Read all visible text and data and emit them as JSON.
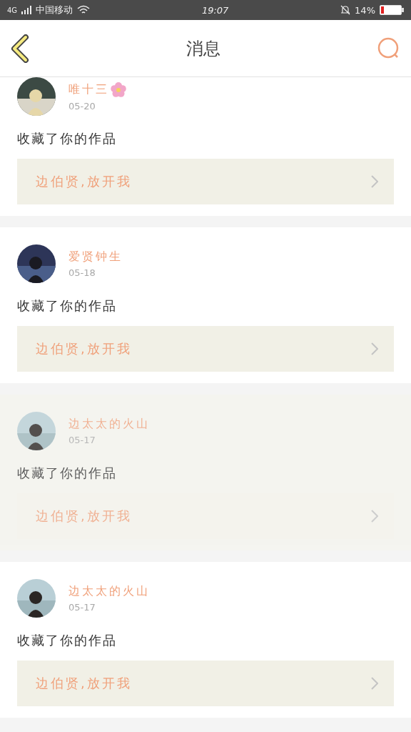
{
  "status_bar": {
    "network": "4G",
    "carrier": "中国移动",
    "time": "19:07",
    "battery": "14%"
  },
  "header": {
    "title": "消息"
  },
  "messages": [
    {
      "user": "唯十三",
      "flower": true,
      "date": "05-20",
      "action": "收藏了你的作品",
      "work": "边伯贤,放开我",
      "pressed": false
    },
    {
      "user": "爱贤钟生",
      "flower": false,
      "date": "05-18",
      "action": "收藏了你的作品",
      "work": "边伯贤,放开我",
      "pressed": false
    },
    {
      "user": "边太太的火山",
      "flower": false,
      "date": "05-17",
      "action": "收藏了你的作品",
      "work": "边伯贤,放开我",
      "pressed": true
    },
    {
      "user": "边太太的火山",
      "flower": false,
      "date": "05-17",
      "action": "收藏了你的作品",
      "work": "边伯贤,放开我",
      "pressed": false
    }
  ]
}
